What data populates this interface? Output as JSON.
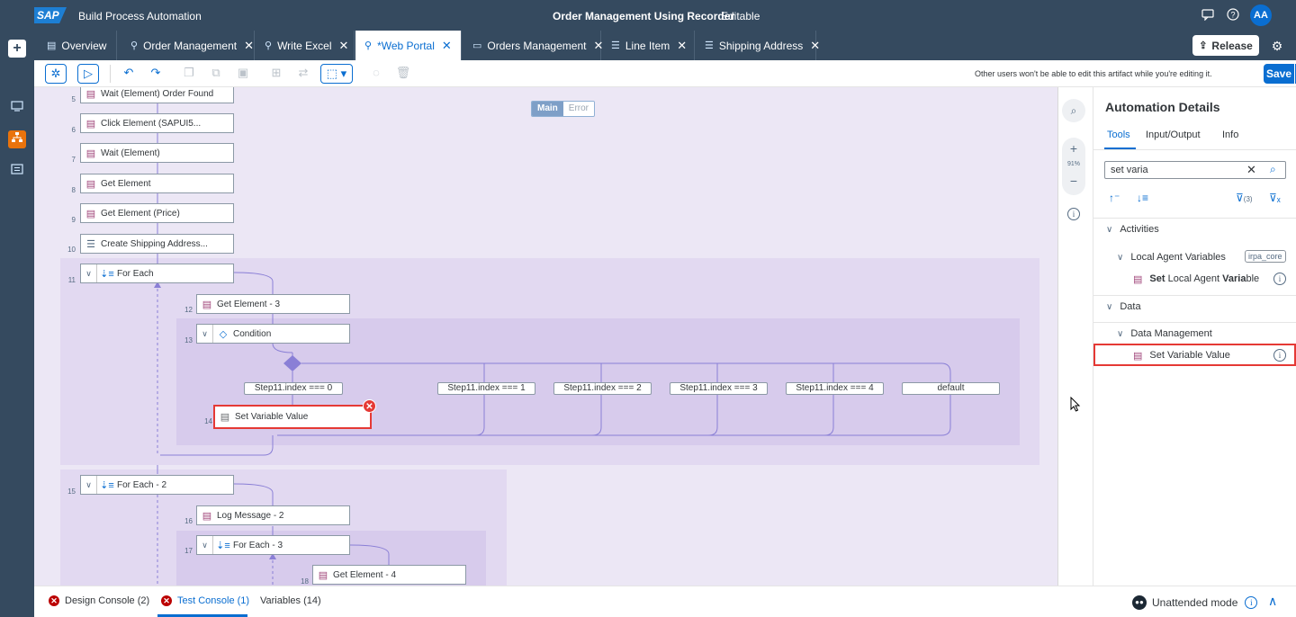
{
  "shell": {
    "logo": "SAP",
    "product": "Build Process Automation",
    "title": "Order Management Using Recorder",
    "status": "Editable",
    "avatar": "AA"
  },
  "tabs": [
    {
      "label": "Overview",
      "icon": "document-icon"
    },
    {
      "label": "Order Management",
      "icon": "process-icon"
    },
    {
      "label": "Write Excel",
      "icon": "process-icon"
    },
    {
      "label": "*Web Portal",
      "icon": "process-icon"
    },
    {
      "label": "Orders Management",
      "icon": "monitor-icon"
    },
    {
      "label": "Line Item",
      "icon": "list-icon"
    },
    {
      "label": "Shipping Address",
      "icon": "list-icon"
    }
  ],
  "release_label": "Release",
  "toolbar": {
    "edit_note": "Other users won't be able to edit this artifact while you're editing it.",
    "save_label": "Save"
  },
  "canvas": {
    "mode_main": "Main",
    "mode_error": "Error",
    "zoom": "91%",
    "nodes": [
      {
        "line": "5",
        "label": "Wait (Element) Order Found"
      },
      {
        "line": "6",
        "label": "Click Element (SAPUI5..."
      },
      {
        "line": "7",
        "label": "Wait (Element)"
      },
      {
        "line": "8",
        "label": "Get Element"
      },
      {
        "line": "9",
        "label": "Get Element (Price)"
      },
      {
        "line": "10",
        "label": "Create Shipping Address..."
      },
      {
        "line": "11",
        "label": "For Each"
      },
      {
        "line": "12",
        "label": "Get Element - 3"
      },
      {
        "line": "13",
        "label": "Condition"
      },
      {
        "line": "14",
        "label": "Set Variable Value"
      },
      {
        "line": "15",
        "label": "For Each - 2"
      },
      {
        "line": "16",
        "label": "Log Message - 2"
      },
      {
        "line": "17",
        "label": "For Each - 3"
      },
      {
        "line": "18",
        "label": "Get Element - 4"
      }
    ],
    "conditions": [
      "Step11.index === 0",
      "Step11.index === 1",
      "Step11.index === 2",
      "Step11.index === 3",
      "Step11.index === 4",
      "default"
    ]
  },
  "panel": {
    "title": "Automation Details",
    "tabs": [
      "Tools",
      "Input/Output",
      "Info"
    ],
    "search_value": "set varia",
    "sections": [
      {
        "label": "Activities"
      },
      {
        "label": "Local Agent Variables",
        "tag": "irpa_core"
      },
      {
        "label": "Data"
      },
      {
        "label": "Data Management"
      }
    ],
    "items": [
      {
        "bold1": "Set",
        "plain1": " Local Agent ",
        "bold2": "Varia",
        "plain2": "ble"
      },
      {
        "label": "Set Variable Value"
      }
    ],
    "filter_count": "(3)"
  },
  "footer": {
    "design_console": "Design Console (2)",
    "test_console": "Test Console (1)",
    "variables": "Variables (14)",
    "mode": "Unattended mode"
  }
}
